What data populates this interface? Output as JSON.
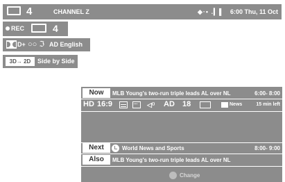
{
  "topbar": {
    "channel_number": "4",
    "channel_name": "CHANNEL Z",
    "signal_icons": "◆·• .▎▌",
    "datetime": "6:00 Thu, 11 Oct"
  },
  "recording": {
    "label": "REC",
    "channel_number": "4"
  },
  "audio": {
    "dplus_label": "D+",
    "surround_icons": "○○ ℑ",
    "ad_language": "AD English"
  },
  "threed": {
    "badge": "3D→ 2D",
    "mode": "Side by Side"
  },
  "info": {
    "now": {
      "label": "Now",
      "title": "MLB Young's two-run triple leads AL over NL",
      "time": "6:00- 8:00"
    },
    "icons": {
      "hd": "HD",
      "aspect": "16:9",
      "audio_icon": "◁⁽⁾",
      "ad": "AD",
      "rating": "18",
      "genre": "News",
      "remaining": "15 min left"
    },
    "next": {
      "label": "Next",
      "title": "World News and Sports",
      "time": "8:00- 9:00"
    },
    "also": {
      "label": "Also",
      "title": "MLB Young's two-run triple leads AL over NL"
    },
    "change_label": "Change"
  }
}
